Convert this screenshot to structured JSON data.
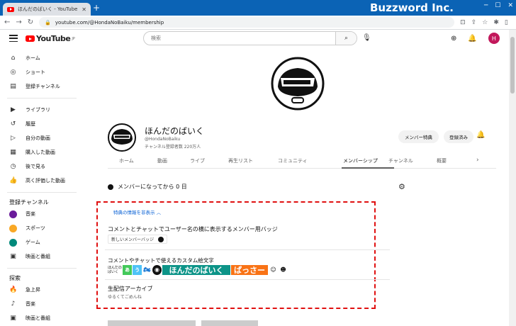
{
  "browser": {
    "tab_title": "ほんだのばいく - YouTube",
    "tab_close": "✕",
    "new_tab": "+",
    "brand": "Buzzword Inc.",
    "url": "youtube.com/@HondaNoBaiku/membership"
  },
  "youtube": {
    "logo": "YouTube",
    "logo_suffix": "JP",
    "search_placeholder": "検索",
    "avatar_letter": "H"
  },
  "sidebar": {
    "main": [
      {
        "icon": "home-icon",
        "label": "ホーム"
      },
      {
        "icon": "shorts-icon",
        "label": "ショート"
      },
      {
        "icon": "subscriptions-icon",
        "label": "登録チャンネル"
      }
    ],
    "library": [
      {
        "icon": "library-icon",
        "label": "ライブラリ"
      },
      {
        "icon": "history-icon",
        "label": "履歴"
      },
      {
        "icon": "your-videos-icon",
        "label": "自分の動画"
      },
      {
        "icon": "purchases-icon",
        "label": "購入した動画"
      },
      {
        "icon": "watch-later-icon",
        "label": "後で見る"
      },
      {
        "icon": "liked-icon",
        "label": "高く評価した動画"
      }
    ],
    "subs_header": "登録チャンネル",
    "subs": [
      {
        "label": "音楽",
        "color": "#6a1b9a"
      },
      {
        "label": "スポーツ",
        "color": "#1565c0"
      },
      {
        "label": "ゲーム",
        "color": "#00897b"
      },
      {
        "icon": "movies-icon",
        "label": "映画と番組"
      }
    ],
    "explore_header": "探索",
    "explore": [
      {
        "icon": "trending-icon",
        "label": "急上昇"
      },
      {
        "icon": "music-icon",
        "label": "音楽"
      },
      {
        "icon": "movies-icon",
        "label": "映画と番組"
      }
    ]
  },
  "channel": {
    "name": "ほんだのばいく",
    "handle": "@HondaNoBaiku",
    "subscribers": "チャンネル登録者数 220万人",
    "member_perks_button": "メンバー特典",
    "subscribed_button": "登録済み"
  },
  "tabs": [
    "ホーム",
    "動画",
    "ライブ",
    "再生リスト",
    "コミュニティ",
    "メンバーシップ",
    "チャンネル",
    "概要"
  ],
  "active_tab": "メンバーシップ",
  "membership": {
    "status": "メンバーになってから 0 日",
    "perks_toggle": "特典の情報を非表示",
    "badge_title": "コメントとチャットでユーザー名の横に表示するメンバー用バッジ",
    "badge_chip": "新しいメンバーバッジ",
    "emoji_title": "コメントやチャットで使えるカスタム絵文字",
    "emoji_prefix": "ほんだのばいく",
    "emoji_text1": "ほんだのばいく",
    "emoji_text2": "ぱっさー",
    "live_title": "生配信アーカイブ",
    "live_sub": "ゆるくてごめんね"
  },
  "colors": {
    "titlebar": "#0b63b5",
    "accent_red": "#ff0000",
    "link_blue": "#065fd4",
    "highlight_dash": "#e01010"
  }
}
